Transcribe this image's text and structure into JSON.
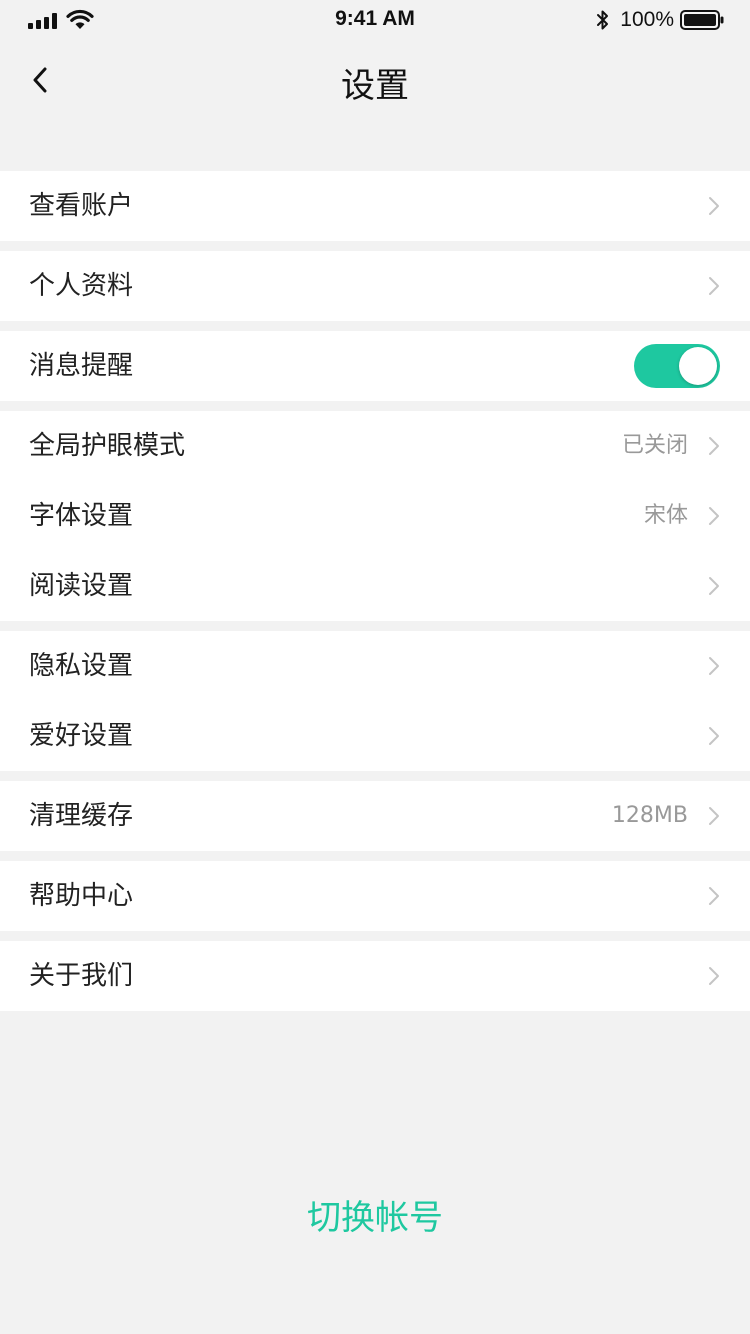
{
  "status_bar": {
    "time": "9:41 AM",
    "battery_percent": "100%",
    "icons": [
      "signal-icon",
      "wifi-icon",
      "bluetooth-icon",
      "battery-icon"
    ]
  },
  "nav": {
    "back_icon": "chevron-left-icon",
    "title": "设置"
  },
  "groups": [
    {
      "items": [
        {
          "label": "查看账户"
        }
      ]
    },
    {
      "items": [
        {
          "label": "个人资料"
        }
      ]
    },
    {
      "items": [
        {
          "label": "消息提醒",
          "toggle_on": true
        }
      ]
    },
    {
      "items": [
        {
          "label": "全局护眼模式",
          "value": "已关闭"
        },
        {
          "label": "字体设置",
          "value": "宋体"
        },
        {
          "label": "阅读设置"
        }
      ]
    },
    {
      "items": [
        {
          "label": "隐私设置"
        },
        {
          "label": "爱好设置"
        }
      ]
    },
    {
      "items": [
        {
          "label": "清理缓存",
          "value": "128MB"
        }
      ]
    },
    {
      "items": [
        {
          "label": "帮助中心"
        }
      ]
    },
    {
      "items": [
        {
          "label": "关于我们"
        }
      ]
    }
  ],
  "footer": {
    "switch_account_label": "切换帐号"
  },
  "colors": {
    "accent": "#1ec8a0",
    "page_background": "#f2f2f2",
    "chevron": "#c4c4c4",
    "value_text": "#999999"
  }
}
